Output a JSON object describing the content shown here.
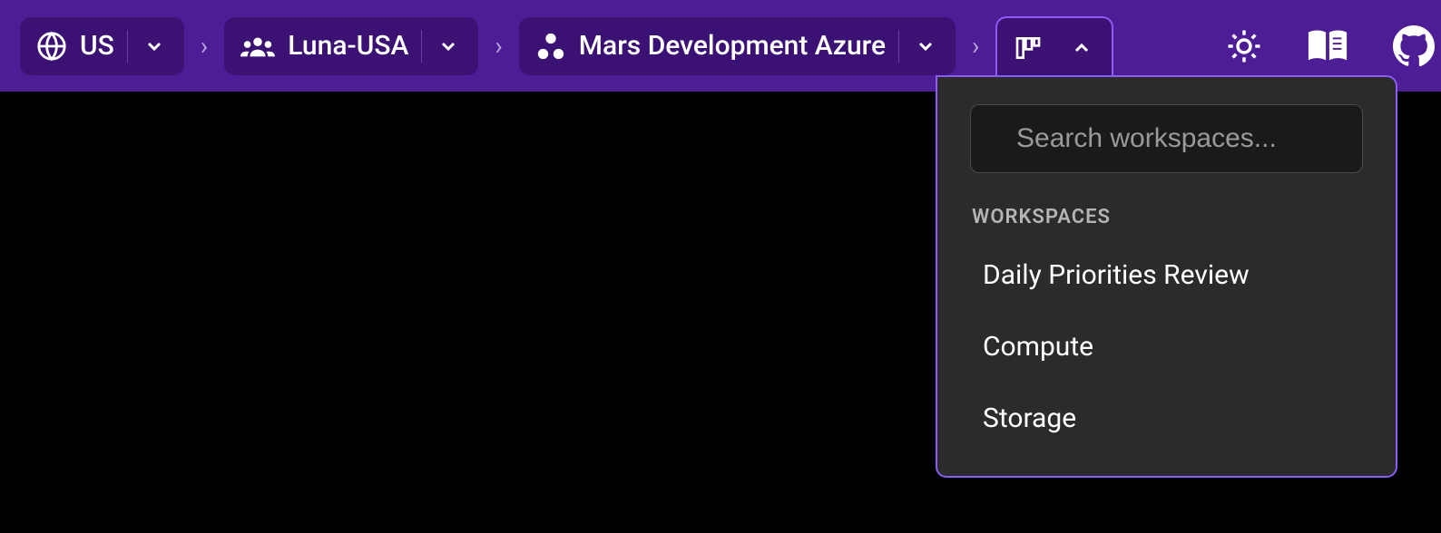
{
  "breadcrumb": {
    "region": {
      "label": "US",
      "icon": "globe-icon"
    },
    "org": {
      "label": "Luna-USA",
      "icon": "people-icon"
    },
    "env": {
      "label": "Mars Development Azure",
      "icon": "hierarchy-icon"
    }
  },
  "workspace_dropdown": {
    "search_placeholder": "Search workspaces...",
    "section_label": "WORKSPACES",
    "items": [
      {
        "label": "Daily Priorities Review"
      },
      {
        "label": "Compute"
      },
      {
        "label": "Storage"
      }
    ]
  },
  "toolbar_icons": {
    "theme": "sun-icon",
    "docs": "book-icon",
    "github": "github-icon"
  }
}
